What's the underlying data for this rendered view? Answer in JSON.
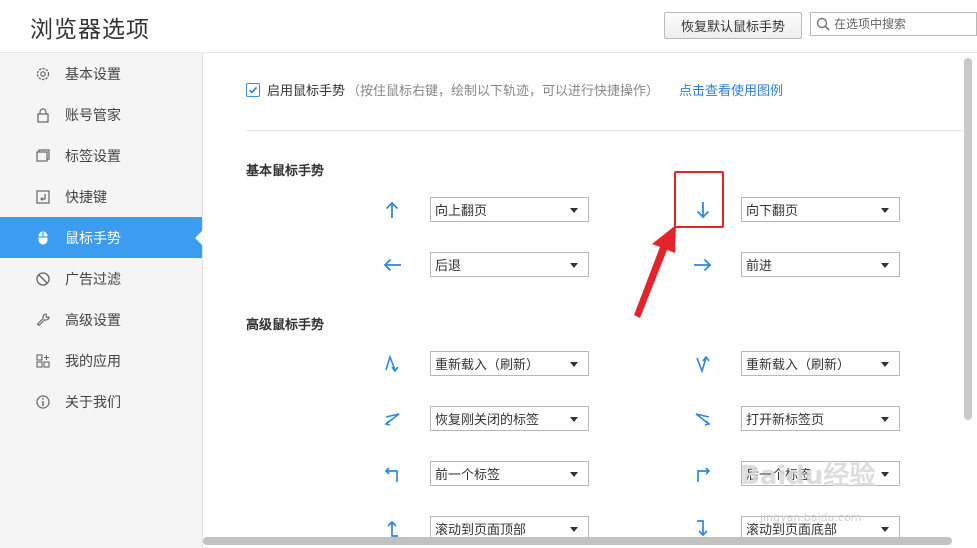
{
  "header": {
    "title": "浏览器选项",
    "reset_button": "恢复默认鼠标手势",
    "search_placeholder": "在选项中搜索"
  },
  "sidebar": {
    "items": [
      {
        "label": "基本设置",
        "icon": "gear-icon"
      },
      {
        "label": "账号管家",
        "icon": "lock-icon"
      },
      {
        "label": "标签设置",
        "icon": "tabs-icon"
      },
      {
        "label": "快捷键",
        "icon": "keyboard-icon"
      },
      {
        "label": "鼠标手势",
        "icon": "mouse-icon",
        "active": true
      },
      {
        "label": "广告过滤",
        "icon": "block-icon"
      },
      {
        "label": "高级设置",
        "icon": "wrench-icon"
      },
      {
        "label": "我的应用",
        "icon": "apps-icon"
      },
      {
        "label": "关于我们",
        "icon": "info-icon"
      }
    ]
  },
  "main": {
    "enable": {
      "checked": true,
      "label": "启用鼠标手势",
      "hint": "（按住鼠标右键，绘制以下轨迹，可以进行快捷操作）",
      "link": "点击查看使用图例"
    },
    "basic_title": "基本鼠标手势",
    "advanced_title": "高级鼠标手势",
    "basic": [
      {
        "icon": "arrow-up-icon",
        "value": "向上翻页"
      },
      {
        "icon": "arrow-down-icon",
        "value": "向下翻页"
      },
      {
        "icon": "arrow-left-icon",
        "value": "后退"
      },
      {
        "icon": "arrow-right-icon",
        "value": "前进"
      }
    ],
    "advanced": [
      {
        "icon": "gesture-up-down-icon",
        "value": "重新载入（刷新）"
      },
      {
        "icon": "gesture-down-up-icon",
        "value": "重新载入（刷新）"
      },
      {
        "icon": "gesture-right-left-icon",
        "value": "恢复刚关闭的标签"
      },
      {
        "icon": "gesture-left-right-icon",
        "value": "打开新标签页"
      },
      {
        "icon": "gesture-up-left-icon",
        "value": "前一个标签"
      },
      {
        "icon": "gesture-up-right-icon",
        "value": "后一个标签"
      },
      {
        "icon": "gesture-left-up-icon",
        "value": "滚动到页面顶部"
      },
      {
        "icon": "gesture-right-down-icon",
        "value": "滚动到页面底部"
      }
    ]
  },
  "watermark": {
    "text": "Baidu经验",
    "sub": "jingyan.baidu.com"
  },
  "colors": {
    "accent": "#3c9cf0",
    "link": "#2f7fd8",
    "annotation": "#e3242b"
  }
}
